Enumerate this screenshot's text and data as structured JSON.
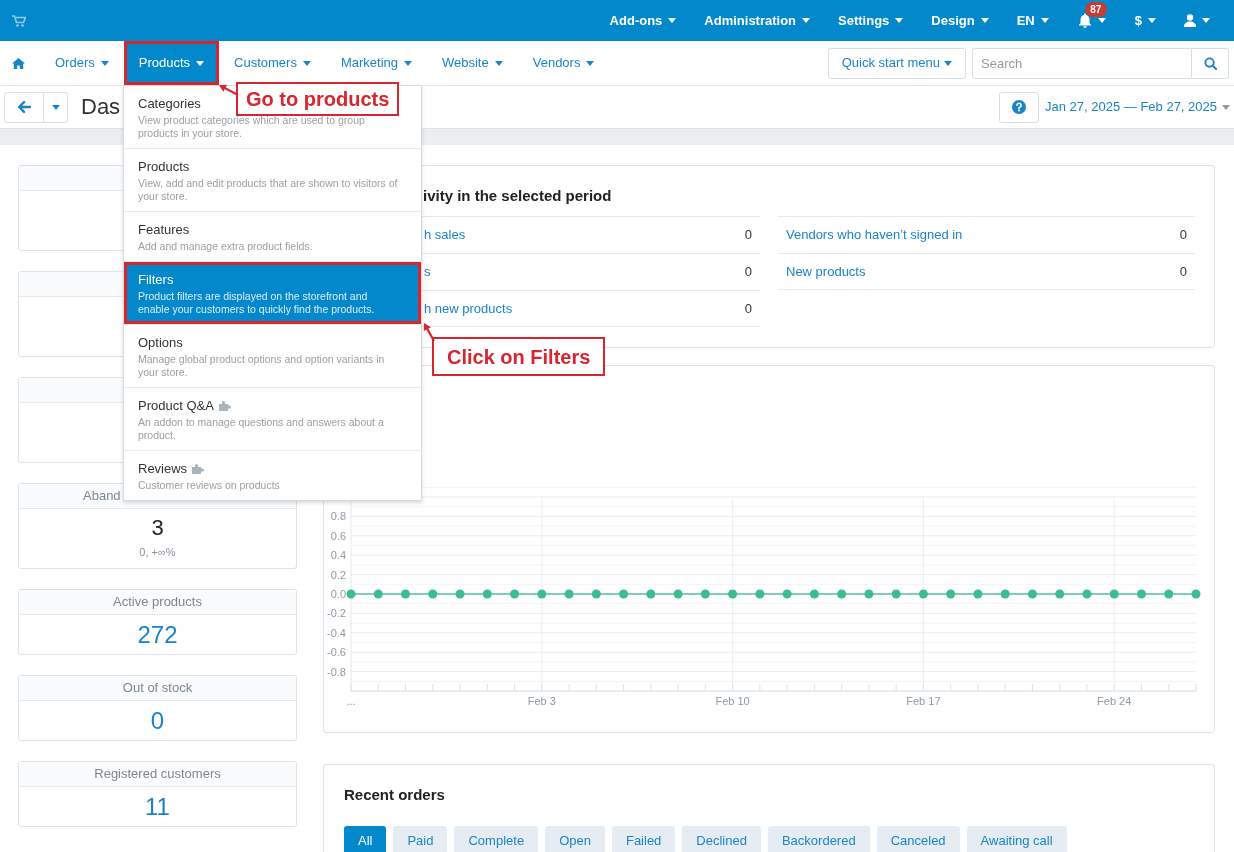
{
  "top_bar": {
    "menu": [
      {
        "label": "Add-ons"
      },
      {
        "label": "Administration"
      },
      {
        "label": "Settings"
      },
      {
        "label": "Design"
      },
      {
        "label": "EN"
      }
    ],
    "notifications": {
      "badge": "87"
    },
    "currency": "$"
  },
  "nav": {
    "items": [
      {
        "label": "Orders",
        "selected": false,
        "highlighted": false
      },
      {
        "label": "Products",
        "selected": true,
        "highlighted": true
      },
      {
        "label": "Customers",
        "selected": false,
        "highlighted": false
      },
      {
        "label": "Marketing",
        "selected": false,
        "highlighted": false
      },
      {
        "label": "Website",
        "selected": false,
        "highlighted": false
      },
      {
        "label": "Vendors",
        "selected": false,
        "highlighted": false
      }
    ],
    "quick_start": "Quick start menu",
    "search": {
      "placeholder": "Search"
    }
  },
  "title_bar": {
    "title": "Das",
    "date_range": "Jan 27, 2025 — Feb 27, 2025"
  },
  "products_menu": {
    "items": [
      {
        "title": "Categories",
        "description": "View product categories which are used to group products in your store.",
        "addon": false,
        "selected": false,
        "highlighted": false
      },
      {
        "title": "Products",
        "description": "View, add and edit products that are shown to visitors of your store.",
        "addon": false,
        "selected": false,
        "highlighted": false
      },
      {
        "title": "Features",
        "description": "Add and manage extra product fields.",
        "addon": false,
        "selected": false,
        "highlighted": false
      },
      {
        "title": "Filters",
        "description": "Product filters are displayed on the storefront and enable your customers to quickly find the products.",
        "addon": false,
        "selected": true,
        "highlighted": true
      },
      {
        "title": "Options",
        "description": "Manage global product options and option variants in your store.",
        "addon": false,
        "selected": false,
        "highlighted": false
      },
      {
        "title": "Product Q&A",
        "description": "An addon to manage questions and answers about a product.",
        "addon": true,
        "selected": false,
        "highlighted": false
      },
      {
        "title": "Reviews",
        "description": "Customer reviews on products",
        "addon": true,
        "selected": false,
        "highlighted": false
      }
    ]
  },
  "stat_cards": [
    {
      "kind": "covered"
    },
    {
      "kind": "covered"
    },
    {
      "kind": "covered"
    },
    {
      "kind": "counter",
      "title": "Aband",
      "value": "3",
      "change": "0, +∞%"
    },
    {
      "kind": "link",
      "title": "Active products",
      "value": "272"
    },
    {
      "kind": "link",
      "title": "Out of stock",
      "value": "0"
    },
    {
      "kind": "link",
      "title": "Registered customers",
      "value": "11"
    }
  ],
  "activity": {
    "title": "ivity in the selected period",
    "left_rows": [
      {
        "label": "h sales",
        "value": "0"
      },
      {
        "label": "s",
        "value": "0"
      },
      {
        "label": "h new products",
        "value": "0"
      }
    ],
    "right_rows": [
      {
        "label": "Vendors who haven’t signed in",
        "value": "0"
      },
      {
        "label": "New products",
        "value": "0"
      }
    ]
  },
  "chart": {
    "chart_data": {
      "type": "line",
      "grid": true,
      "categories": [
        "...",
        null,
        null,
        null,
        null,
        null,
        null,
        "Feb 3",
        null,
        null,
        null,
        null,
        null,
        null,
        "Feb 10",
        null,
        null,
        null,
        null,
        null,
        null,
        "Feb 17",
        null,
        null,
        null,
        null,
        null,
        null,
        "Feb 24",
        null,
        null,
        null
      ],
      "ylim": [
        -1,
        1.1
      ],
      "yticks": [
        {
          "value": 0.8,
          "label": "0.8"
        },
        {
          "value": 0.6,
          "label": "0.6"
        },
        {
          "value": 0.4,
          "label": "0.4"
        },
        {
          "value": 0.2,
          "label": "0.2"
        },
        {
          "value": 0,
          "label": "0.0"
        },
        {
          "value": -0.2,
          "label": "-0.2"
        },
        {
          "value": -0.4,
          "label": "-0.4"
        },
        {
          "value": -0.6,
          "label": "-0.6"
        },
        {
          "value": -0.8,
          "label": "-0.8"
        }
      ],
      "series": [
        {
          "color": "#3dbd8e",
          "marker": true,
          "values": [
            0,
            0,
            0,
            0,
            0,
            0,
            0,
            0,
            0,
            0,
            0,
            0,
            0,
            0,
            0,
            0,
            0,
            0,
            0,
            0,
            0,
            0,
            0,
            0,
            0,
            0,
            0,
            0,
            0,
            0,
            0,
            0
          ]
        }
      ]
    }
  },
  "recent_orders": {
    "title": "Recent orders",
    "tabs": [
      {
        "label": "All",
        "selected": true
      },
      {
        "label": "Paid",
        "selected": false
      },
      {
        "label": "Complete",
        "selected": false
      },
      {
        "label": "Open",
        "selected": false
      },
      {
        "label": "Failed",
        "selected": false
      },
      {
        "label": "Declined",
        "selected": false
      },
      {
        "label": "Backordered",
        "selected": false
      },
      {
        "label": "Canceled",
        "selected": false
      },
      {
        "label": "Awaiting call",
        "selected": false
      }
    ]
  },
  "annotations": [
    {
      "text": "Go to products"
    },
    {
      "text": "Click on Filters"
    }
  ]
}
